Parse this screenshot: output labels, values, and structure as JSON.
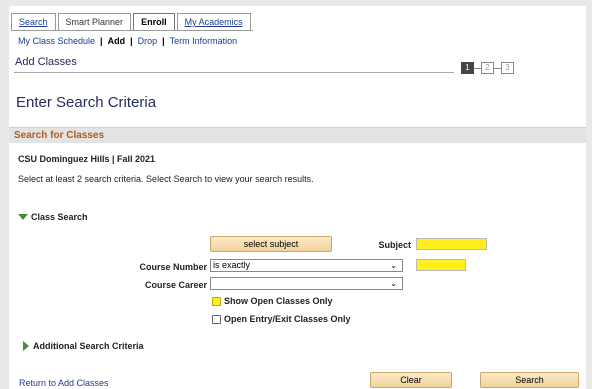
{
  "tabs": {
    "search": "Search",
    "smart_planner": "Smart Planner",
    "enroll": "Enroll",
    "my_academics": "My Academics"
  },
  "subnav": {
    "my_class_schedule": "My Class Schedule",
    "add": "Add",
    "drop": "Drop",
    "term_information": "Term Information",
    "separator": "|"
  },
  "page_title_small": "Add Classes",
  "steps": [
    "1",
    "2",
    "3"
  ],
  "heading": "Enter Search Criteria",
  "section_title": "Search for Classes",
  "school_term": "CSU Dominguez Hills | Fall 2021",
  "instructions": "Select at least 2 search criteria. Select Search to view your search results.",
  "class_search": {
    "label": "Class Search",
    "select_subject_button": "select subject",
    "subject_label": "Subject",
    "course_number_label": "Course Number",
    "course_number_operator": "is exactly",
    "course_career_label": "Course Career",
    "course_career_value": "",
    "show_open_only": "Show Open Classes Only",
    "open_entry_exit": "Open Entry/Exit Classes Only"
  },
  "additional_criteria": "Additional Search Criteria",
  "footer": {
    "return_link": "Return to Add Classes",
    "clear_button": "Clear",
    "search_button": "Search"
  },
  "colors": {
    "highlight": "#ffef1f",
    "section_title": "#b35a1f",
    "link": "#1a3d8f",
    "button": "#f2d39a"
  }
}
